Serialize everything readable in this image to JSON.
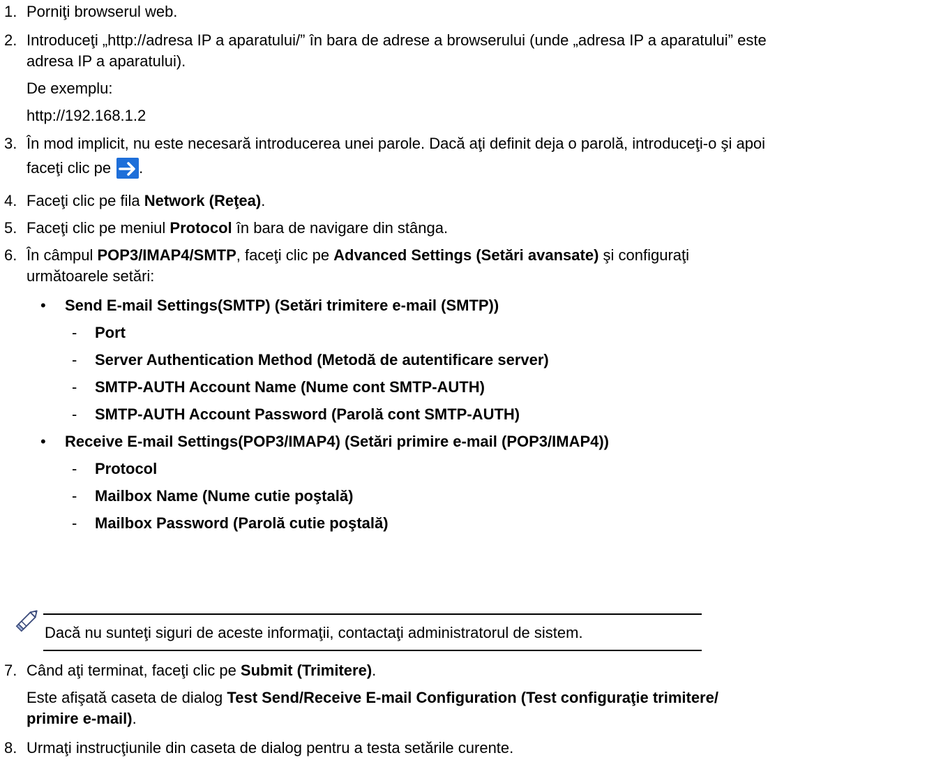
{
  "steps": [
    {
      "num": "1.",
      "text": "Porniţi browserul web."
    },
    {
      "num": "2.",
      "line1": "Introduceţi „http://adresa IP a aparatului/” în bara de adrese a browserului (unde „adresa IP a aparatului” este",
      "line2": "adresa IP a aparatului).",
      "example_label": "De exemplu:",
      "example_url": "http://192.168.1.2"
    },
    {
      "num": "3.",
      "line1": "În mod implicit, nu este necesară introducerea unei parole. Dacă aţi definit deja o parolă, introduceţi-o şi apoi",
      "line2_pre": "faceţi clic pe ",
      "line2_post": "."
    },
    {
      "num": "4.",
      "pre": "Faceţi clic pe fila ",
      "bold": "Network (Reţea)",
      "post": "."
    },
    {
      "num": "5.",
      "pre": "Faceţi clic pe meniul ",
      "bold": "Protocol",
      "post": " în bara de navigare din stânga."
    },
    {
      "num": "6.",
      "pre": "În câmpul ",
      "bold1": "POP3/IMAP4/SMTP",
      "mid": ", faceţi clic pe ",
      "bold2": "Advanced Settings (Setări avansate)",
      "post": " şi configuraţi",
      "line2": "următoarele setări:"
    },
    {
      "num": "7.",
      "pre": "Când aţi terminat, faceţi clic pe ",
      "bold": "Submit (Trimitere)",
      "post": ".",
      "sub_pre": "Este afişată caseta de dialog ",
      "sub_bold1": "Test Send/Receive E-mail Configuration (Test configuraţie trimitere/",
      "sub_bold2": "primire e-mail)",
      "sub_post": "."
    },
    {
      "num": "8.",
      "text": "Urmaţi instrucţiunile din caseta de dialog pentru a testa setările curente."
    }
  ],
  "settings": {
    "send_group": "Send E-mail Settings(SMTP) (Setări trimitere e-mail (SMTP))",
    "send_items": [
      "Port",
      "Server Authentication Method (Metodă de autentificare server)",
      "SMTP-AUTH Account Name (Nume cont SMTP-AUTH)",
      "SMTP-AUTH Account Password (Parolă cont SMTP-AUTH)"
    ],
    "receive_group": "Receive E-mail Settings(POP3/IMAP4) (Setări primire e-mail (POP3/IMAP4))",
    "receive_items": [
      "Protocol",
      "Mailbox Name (Nume cutie poştală)",
      "Mailbox Password (Parolă cutie poştală)"
    ],
    "bullet": "•",
    "dash": "-"
  },
  "note": {
    "text": "Dacă nu sunteţi siguri de aceste informaţii, contactaţi administratorul de sistem.",
    "icon": "pencil-icon"
  },
  "colors": {
    "arrow_button": "#1e6fd9"
  }
}
